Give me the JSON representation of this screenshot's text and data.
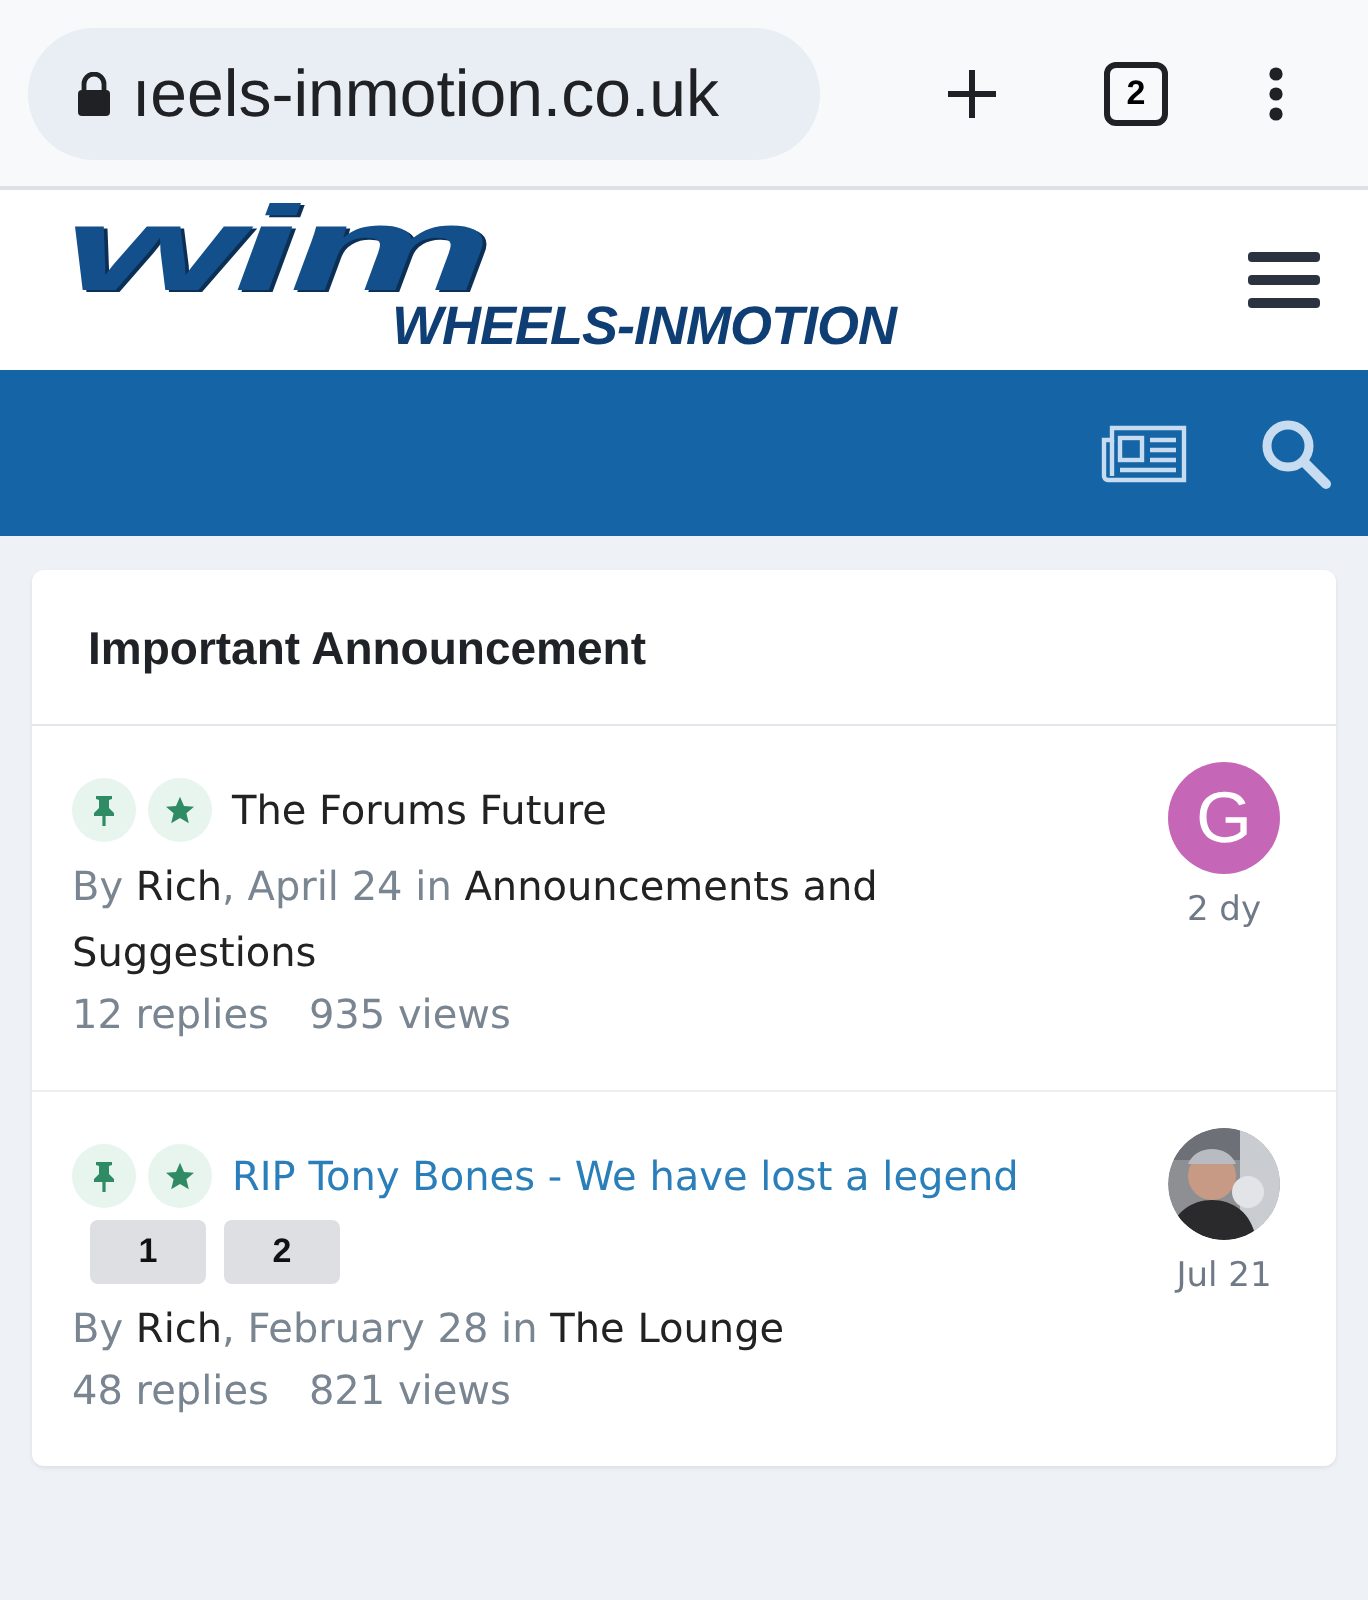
{
  "browser": {
    "url": "ıeels-inmotion.co.uk",
    "tab_count": "2"
  },
  "logo": {
    "mark": "wim",
    "name": "WHEELS-INMOTION"
  },
  "section": {
    "title": "Important Announcement"
  },
  "topics": [
    {
      "title": "The Forums Future",
      "pinned": true,
      "featured": true,
      "unread": false,
      "by": "By ",
      "author": "Rich",
      "date_text": ", April 24 in ",
      "forum": "Announcements and Suggestions",
      "replies": "12 replies",
      "views": "935 views",
      "avatar": {
        "kind": "letter",
        "letter": "G",
        "color": "#c567b6"
      },
      "time": "2 dy"
    },
    {
      "title": "RIP Tony Bones - We have lost a legend",
      "pinned": true,
      "featured": true,
      "unread": true,
      "pages": [
        "1",
        "2"
      ],
      "by": "By ",
      "author": "Rich",
      "date_text": ", February 28 in ",
      "forum": "The Lounge",
      "replies": "48 replies",
      "views": "821 views",
      "time": "Jul 21"
    }
  ]
}
